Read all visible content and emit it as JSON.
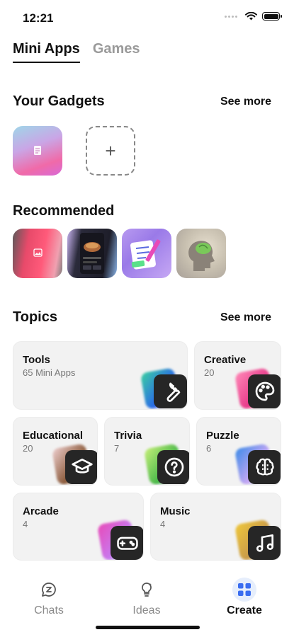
{
  "status_bar": {
    "time": "12:21"
  },
  "tabs": [
    {
      "label": "Mini Apps",
      "active": true
    },
    {
      "label": "Games",
      "active": false
    }
  ],
  "gadgets": {
    "title": "Your Gadgets",
    "see_more": "See more",
    "add_symbol": "+"
  },
  "recommended": {
    "title": "Recommended"
  },
  "topics": {
    "title": "Topics",
    "see_more": "See more",
    "cards": [
      {
        "title": "Tools",
        "count": "65 Mini Apps",
        "icon": "wrench-icon"
      },
      {
        "title": "Creative",
        "count": "20",
        "icon": "palette-icon"
      },
      {
        "title": "Educational",
        "count": "20",
        "icon": "graduation-cap-icon"
      },
      {
        "title": "Trivia",
        "count": "7",
        "icon": "question-icon"
      },
      {
        "title": "Puzzle",
        "count": "6",
        "icon": "brain-icon"
      },
      {
        "title": "Arcade",
        "count": "4",
        "icon": "gamepad-icon"
      },
      {
        "title": "Music",
        "count": "4",
        "icon": "music-note-icon"
      }
    ]
  },
  "bottom_nav": [
    {
      "label": "Chats",
      "icon": "chat-icon",
      "active": false
    },
    {
      "label": "Ideas",
      "icon": "lightbulb-icon",
      "active": false
    },
    {
      "label": "Create",
      "icon": "grid-icon",
      "active": true
    }
  ],
  "colors": {
    "accent": "#3a6df0",
    "card_bg": "#f2f2f2",
    "icon_tile": "#262626"
  }
}
